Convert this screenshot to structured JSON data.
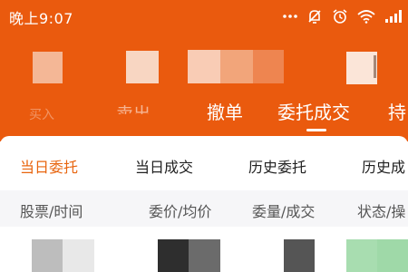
{
  "status_bar": {
    "time": "晚上9:07",
    "icons": [
      "more-dots-icon",
      "mute-icon",
      "alarm-icon",
      "wifi-icon",
      "signal-icon"
    ]
  },
  "top_tabs": [
    {
      "label": "买入",
      "state": "faded"
    },
    {
      "label": "卖出",
      "state": "partial"
    },
    {
      "label": "撤单",
      "state": "normal"
    },
    {
      "label": "委托成交",
      "state": "selected"
    },
    {
      "label": "持",
      "state": "normal"
    }
  ],
  "sub_tabs": [
    {
      "label": "当日委托",
      "active": true
    },
    {
      "label": "当日成交",
      "active": false
    },
    {
      "label": "历史委托",
      "active": false
    },
    {
      "label": "历史成",
      "active": false
    }
  ],
  "columns": [
    "股票/时间",
    "委价/均价",
    "委量/成交",
    "状态/操"
  ],
  "colors": {
    "header_orange": "#ea5a0e",
    "active_tab": "#e8650f",
    "column_row_bg": "#f6f6f8"
  }
}
